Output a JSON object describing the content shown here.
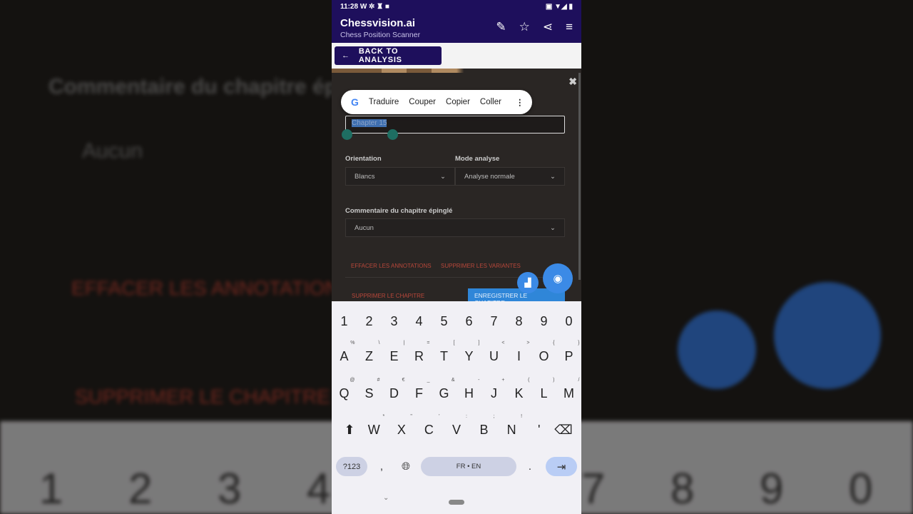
{
  "status": {
    "time": "11:28",
    "left_icons": "W ✲ ♜ ■",
    "right_icons": "▣ ▼◢ ▮"
  },
  "app": {
    "title": "Chessvision.ai",
    "subtitle": "Chess Position Scanner"
  },
  "toolbar": {
    "back_label": "BACK TO ANALYSIS"
  },
  "context_menu": {
    "items": [
      "Traduire",
      "Couper",
      "Copier",
      "Coller"
    ]
  },
  "dialog": {
    "title_value": "Chapter 15",
    "orientation_label": "Orientation",
    "orientation_value": "Blancs",
    "mode_label": "Mode analyse",
    "mode_value": "Analyse normale",
    "comment_label": "Commentaire du chapitre épinglé",
    "comment_value": "Aucun",
    "clear_annotations": "EFFACER LES ANNOTATIONS",
    "delete_variations": "SUPPRIMER LES VARIANTES",
    "delete_chapter": "SUPPRIMER LE CHAPITRE",
    "save_chapter": "ENREGISTRER LE CHAPITRE"
  },
  "keyboard": {
    "numbers": [
      "1",
      "2",
      "3",
      "4",
      "5",
      "6",
      "7",
      "8",
      "9",
      "0"
    ],
    "row1": [
      "A",
      "Z",
      "E",
      "R",
      "T",
      "Y",
      "U",
      "I",
      "O",
      "P"
    ],
    "row1_alt": [
      "%",
      "\\",
      "|",
      "=",
      "[",
      "]",
      "<",
      ">",
      "{",
      "}"
    ],
    "row2": [
      "Q",
      "S",
      "D",
      "F",
      "G",
      "H",
      "J",
      "K",
      "L",
      "M"
    ],
    "row2_alt": [
      "@",
      "#",
      "€",
      "_",
      "&",
      "-",
      "+",
      "(",
      ")",
      "/"
    ],
    "row3": [
      "W",
      "X",
      "C",
      "V",
      "B",
      "N",
      "'"
    ],
    "row3_alt": [
      "*",
      "\"",
      "'",
      ":",
      ";",
      "!",
      ""
    ],
    "symbols": "?123",
    "comma": ",",
    "space": "FR • EN",
    "period": "."
  },
  "colors": {
    "brand": "#1e0f5c",
    "accent": "#3b8ae6",
    "danger": "#b8473a"
  }
}
